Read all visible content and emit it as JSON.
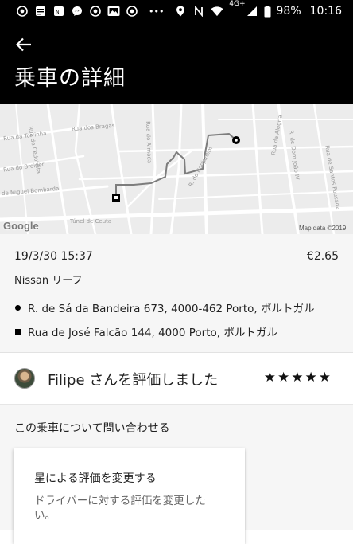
{
  "status_bar": {
    "notification_icons": [
      "chrome-icon",
      "news-icon",
      "photos-icon",
      "messenger-icon",
      "chrome-icon",
      "gallery-icon",
      "chrome-icon"
    ],
    "overflow": "•••",
    "network_type": "4G+",
    "battery": "98%",
    "time": "10:16"
  },
  "header": {
    "title": "乗車の詳細"
  },
  "map": {
    "street_labels": [
      "Rua da Torrinha",
      "Rua dos Bragas",
      "Rua do Breiner",
      "de Miguel Bombarda",
      "Rua de Cedofeita",
      "Rua do Almada",
      "R. do Bonjardim",
      "Rua da Alegria",
      "R. de Dom João IV",
      "Rua de Santos Pousada",
      "Túnel de Ceuta"
    ],
    "logo": "Google",
    "attribution": "Map data ©2019"
  },
  "trip": {
    "datetime": "19/3/30 15:37",
    "fare": "€2.65",
    "vehicle": "Nissan リーフ",
    "pickup": "R. de Sá da Bandeira 673, 4000-462 Porto, ポルトガル",
    "dropoff": "Rua de José Falcão 144, 4000 Porto, ポルトガル"
  },
  "rating": {
    "text": "Filipe さんを評価しました",
    "stars": "★★★★★"
  },
  "help": {
    "title": "この乗車について問い合わせる",
    "card_title": "星による評価を変更する",
    "card_description": "ドライバーに対する評価を変更したい。"
  }
}
